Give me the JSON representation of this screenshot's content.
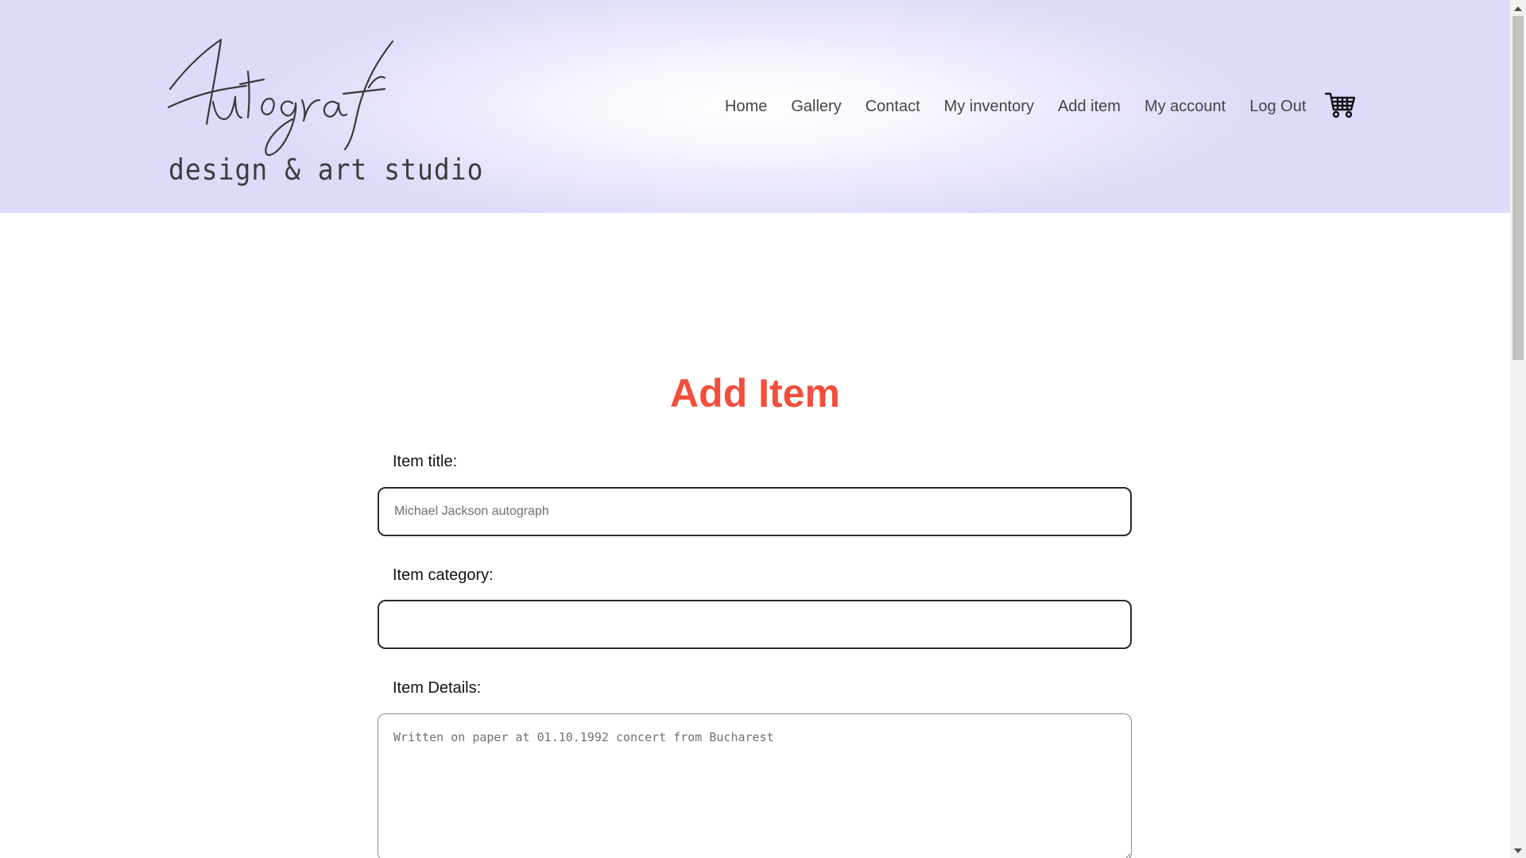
{
  "brand": {
    "script_name": "Autograf",
    "tagline": "design & art studio"
  },
  "nav": {
    "items": [
      {
        "label": "Home"
      },
      {
        "label": "Gallery"
      },
      {
        "label": "Contact"
      },
      {
        "label": "My inventory"
      },
      {
        "label": "Add item"
      },
      {
        "label": "My account"
      },
      {
        "label": "Log Out"
      }
    ],
    "cart_icon": "shopping-cart-icon"
  },
  "form": {
    "title": "Add Item",
    "title_color": "#f24e3b",
    "item_title_label": "Item title:",
    "item_title_placeholder": "Michael Jackson autograph",
    "item_title_value": "",
    "item_category_label": "Item category:",
    "item_category_value": "",
    "item_details_label": "Item Details:",
    "item_details_placeholder": "Written on paper at 01.10.1992 concert from Bucharest"
  },
  "colors": {
    "header_tint": "#dcdbfa",
    "nav_text": "#444444",
    "accent": "#f24e3b"
  }
}
